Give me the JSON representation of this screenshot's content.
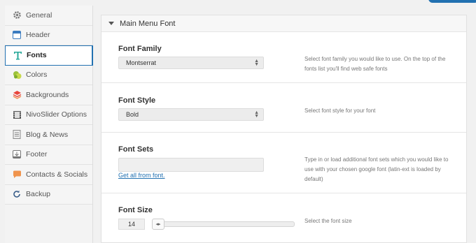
{
  "sidebar": {
    "items": [
      {
        "label": "General",
        "icon": "gear-icon"
      },
      {
        "label": "Header",
        "icon": "header-icon"
      },
      {
        "label": "Fonts",
        "icon": "font-icon"
      },
      {
        "label": "Colors",
        "icon": "palette-icon"
      },
      {
        "label": "Backgrounds",
        "icon": "layers-icon"
      },
      {
        "label": "NivoSlider Options",
        "icon": "film-icon"
      },
      {
        "label": "Blog & News",
        "icon": "document-icon"
      },
      {
        "label": "Footer",
        "icon": "footer-icon"
      },
      {
        "label": "Contacts & Socials",
        "icon": "chat-icon"
      },
      {
        "label": "Backup",
        "icon": "refresh-icon"
      }
    ],
    "active": "Fonts"
  },
  "panel": {
    "title": "Main Menu Font",
    "font_family": {
      "label": "Font Family",
      "value": "Montserrat",
      "description": "Select font family you would like to use. On the top of the fonts list you'll find web safe fonts"
    },
    "font_style": {
      "label": "Font Style",
      "value": "Bold",
      "description": "Select font style for your font"
    },
    "font_sets": {
      "label": "Font Sets",
      "value": "",
      "link": "Get all from font.",
      "description": "Type in or load additional font sets which you would like to use with your chosen google font (latin-ext is loaded by default)"
    },
    "font_size": {
      "label": "Font Size",
      "value": "14",
      "description": "Select the font size"
    }
  },
  "colors": {
    "accent": "#2271b1"
  }
}
